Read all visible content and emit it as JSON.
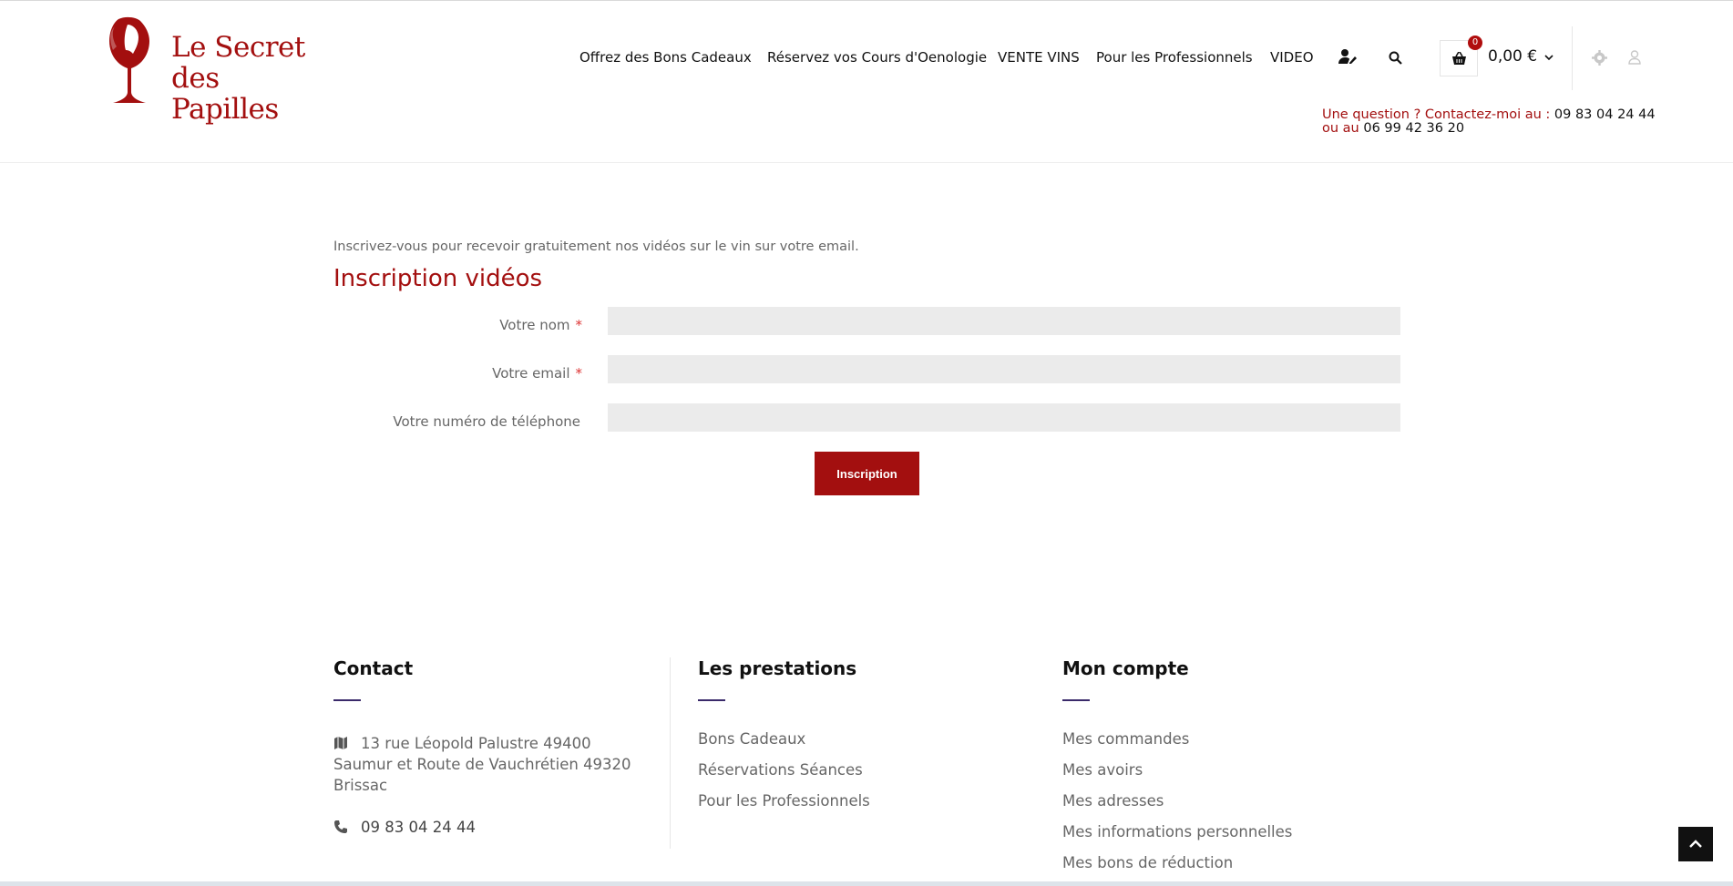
{
  "brand": {
    "line1": "Le Secret",
    "line2": "des Papilles",
    "color": "#a30f0f"
  },
  "nav": {
    "items": [
      {
        "label": "Offrez des Bons Cadeaux"
      },
      {
        "label": "Réservez vos Cours d'Oenologie"
      },
      {
        "label": "VENTE VINS"
      },
      {
        "label": "Pour les Professionnels"
      },
      {
        "label": "VIDEO"
      }
    ],
    "icons": [
      "user-edit-icon",
      "search-icon"
    ]
  },
  "cart": {
    "count": "0",
    "total": "0,00 €",
    "icon": "basket-icon"
  },
  "header_right_icons": [
    "gear-icon",
    "user-icon"
  ],
  "contact_bar": {
    "prefix1": "Une question ? Contactez-moi au : ",
    "phone1": "09 83 04 24 44",
    "prefix2": "ou au ",
    "phone2": "06 99 42 36 20"
  },
  "form": {
    "intro": "Inscrivez-vous pour recevoir gratuitement nos vidéos sur le vin sur votre email.",
    "title": "Inscription vidéos",
    "fields": [
      {
        "label": "Votre nom",
        "required_mark": "*",
        "value": ""
      },
      {
        "label": "Votre email",
        "required_mark": "*",
        "value": ""
      },
      {
        "label": "Votre numéro de téléphone",
        "value": ""
      }
    ],
    "submit_label": "Inscription"
  },
  "footer": {
    "contact": {
      "title": "Contact",
      "address": "13 rue Léopold Palustre 49400 Saumur et Route de Vauchrétien 49320 Brissac",
      "phone": "09 83 04 24 44"
    },
    "services": {
      "title": "Les prestations",
      "links": [
        "Bons Cadeaux",
        "Réservations Séances",
        "Pour les Professionnels"
      ]
    },
    "account": {
      "title": "Mon compte",
      "links": [
        "Mes commandes",
        "Mes avoirs",
        "Mes adresses",
        "Mes informations personnelles",
        "Mes bons de réduction"
      ]
    }
  },
  "colors": {
    "accent": "#a30f0f",
    "footer_bar": "#3a2a6a",
    "field_bg": "#ebebeb"
  }
}
